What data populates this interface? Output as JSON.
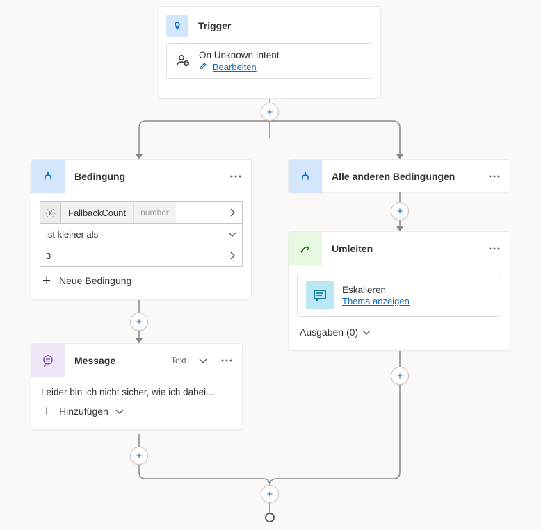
{
  "trigger": {
    "title": "Trigger",
    "event": "On Unknown Intent",
    "edit_label": "Bearbeiten"
  },
  "condition": {
    "title": "Bedingung",
    "var_name": "FallbackCount",
    "var_type": "number",
    "operator": "ist kleiner als",
    "value": "3",
    "add_label": "Neue Bedingung"
  },
  "message": {
    "title": "Message",
    "subtype": "Text",
    "body": "Leider bin ich nicht sicher, wie ich dabei...",
    "add_label": "Hinzufügen"
  },
  "else": {
    "title": "Alle anderen Bedingungen"
  },
  "redirect": {
    "title": "Umleiten",
    "target": "Eskalieren",
    "view_label": "Thema anzeigen",
    "outputs_label": "Ausgaben (0)"
  }
}
